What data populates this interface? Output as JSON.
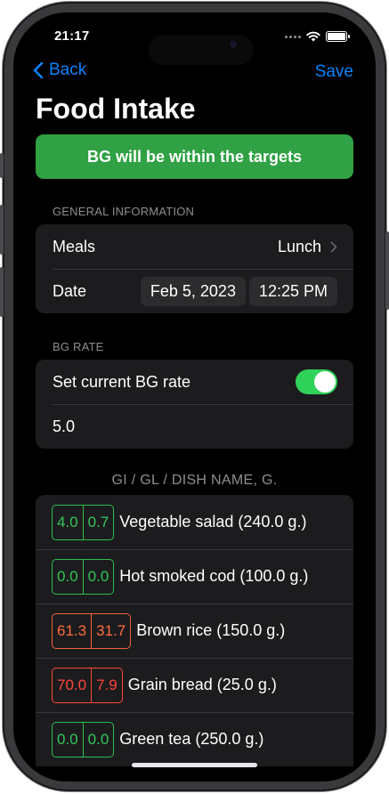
{
  "status": {
    "time": "21:17"
  },
  "nav": {
    "back_label": "Back",
    "save_label": "Save",
    "title": "Food Intake"
  },
  "banner": {
    "text": "BG will be within the targets",
    "color": "#30a144"
  },
  "general": {
    "header": "GENERAL INFORMATION",
    "meals_label": "Meals",
    "meals_value": "Lunch",
    "date_label": "Date",
    "date_value": "Feb 5, 2023",
    "time_value": "12:25 PM"
  },
  "bg_rate": {
    "header": "BG RATE",
    "toggle_label": "Set current BG rate",
    "toggle_on": true,
    "value": "5.0"
  },
  "foods": {
    "header": "GI / GL / DISH NAME, G.",
    "items": [
      {
        "gi": "4.0",
        "gl": "0.7",
        "name": "Vegetable salad (240.0 g.)",
        "level": "green"
      },
      {
        "gi": "0.0",
        "gl": "0.0",
        "name": "Hot smoked cod (100.0 g.)",
        "level": "green"
      },
      {
        "gi": "61.3",
        "gl": "31.7",
        "name": "Brown rice (150.0 g.)",
        "level": "orange"
      },
      {
        "gi": "70.0",
        "gl": "7.9",
        "name": "Grain bread (25.0 g.)",
        "level": "red"
      },
      {
        "gi": "0.0",
        "gl": "0.0",
        "name": "Green tea (250.0 g.)",
        "level": "green"
      }
    ]
  },
  "colors": {
    "accent": "#0a84ff",
    "green": "#34c759",
    "orange": "#ff6b3d",
    "red": "#ff453a"
  }
}
